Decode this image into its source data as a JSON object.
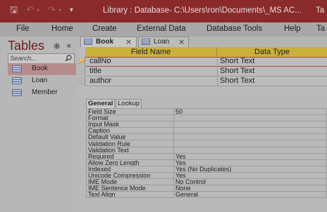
{
  "titlebar": {
    "title": "Library : Database- C:\\Users\\ron\\Documents\\_MS AC...",
    "right_text": "Ta",
    "icons": [
      "save-icon",
      "undo-icon",
      "redo-icon",
      "customize-qat-icon"
    ]
  },
  "ribbon": {
    "tabs": [
      "File",
      "Home",
      "Create",
      "External Data",
      "Database Tools",
      "Help",
      "Ta"
    ]
  },
  "nav": {
    "title": "Tables",
    "search_placeholder": "Search...",
    "items": [
      {
        "label": "Book",
        "selected": true
      },
      {
        "label": "Loan",
        "selected": false
      },
      {
        "label": "Member",
        "selected": false
      }
    ]
  },
  "doc_tabs": [
    {
      "label": "Book",
      "active": true
    },
    {
      "label": "Loan",
      "active": false
    }
  ],
  "design": {
    "headers": [
      "Field Name",
      "Data Type"
    ],
    "rows": [
      {
        "name": "callNo",
        "type": "Short Text",
        "primary_key": true
      },
      {
        "name": "title",
        "type": "Short Text",
        "primary_key": false
      },
      {
        "name": "author",
        "type": "Short Text",
        "primary_key": false
      }
    ]
  },
  "props": {
    "tabs": [
      "General",
      "Lookup"
    ],
    "rows": [
      {
        "key": "Field Size",
        "value": "50"
      },
      {
        "key": "Format",
        "value": ""
      },
      {
        "key": "Input Mask",
        "value": ""
      },
      {
        "key": "Caption",
        "value": ""
      },
      {
        "key": "Default Value",
        "value": ""
      },
      {
        "key": "Validation Rule",
        "value": ""
      },
      {
        "key": "Validation Text",
        "value": ""
      },
      {
        "key": "Required",
        "value": "Yes"
      },
      {
        "key": "Allow Zero Length",
        "value": "Yes"
      },
      {
        "key": "Indexed",
        "value": "Yes (No Duplicates)"
      },
      {
        "key": "Unicode Compression",
        "value": "Yes"
      },
      {
        "key": "IME Mode",
        "value": "No Control"
      },
      {
        "key": "IME Sentence Mode",
        "value": "None"
      },
      {
        "key": "Text Align",
        "value": "General"
      }
    ]
  },
  "colors": {
    "titlebar": "#8a2a2a",
    "header_fill": "#c9b03b",
    "selected_nav": "#b88c8c",
    "nav_title": "#6b1f1f"
  }
}
